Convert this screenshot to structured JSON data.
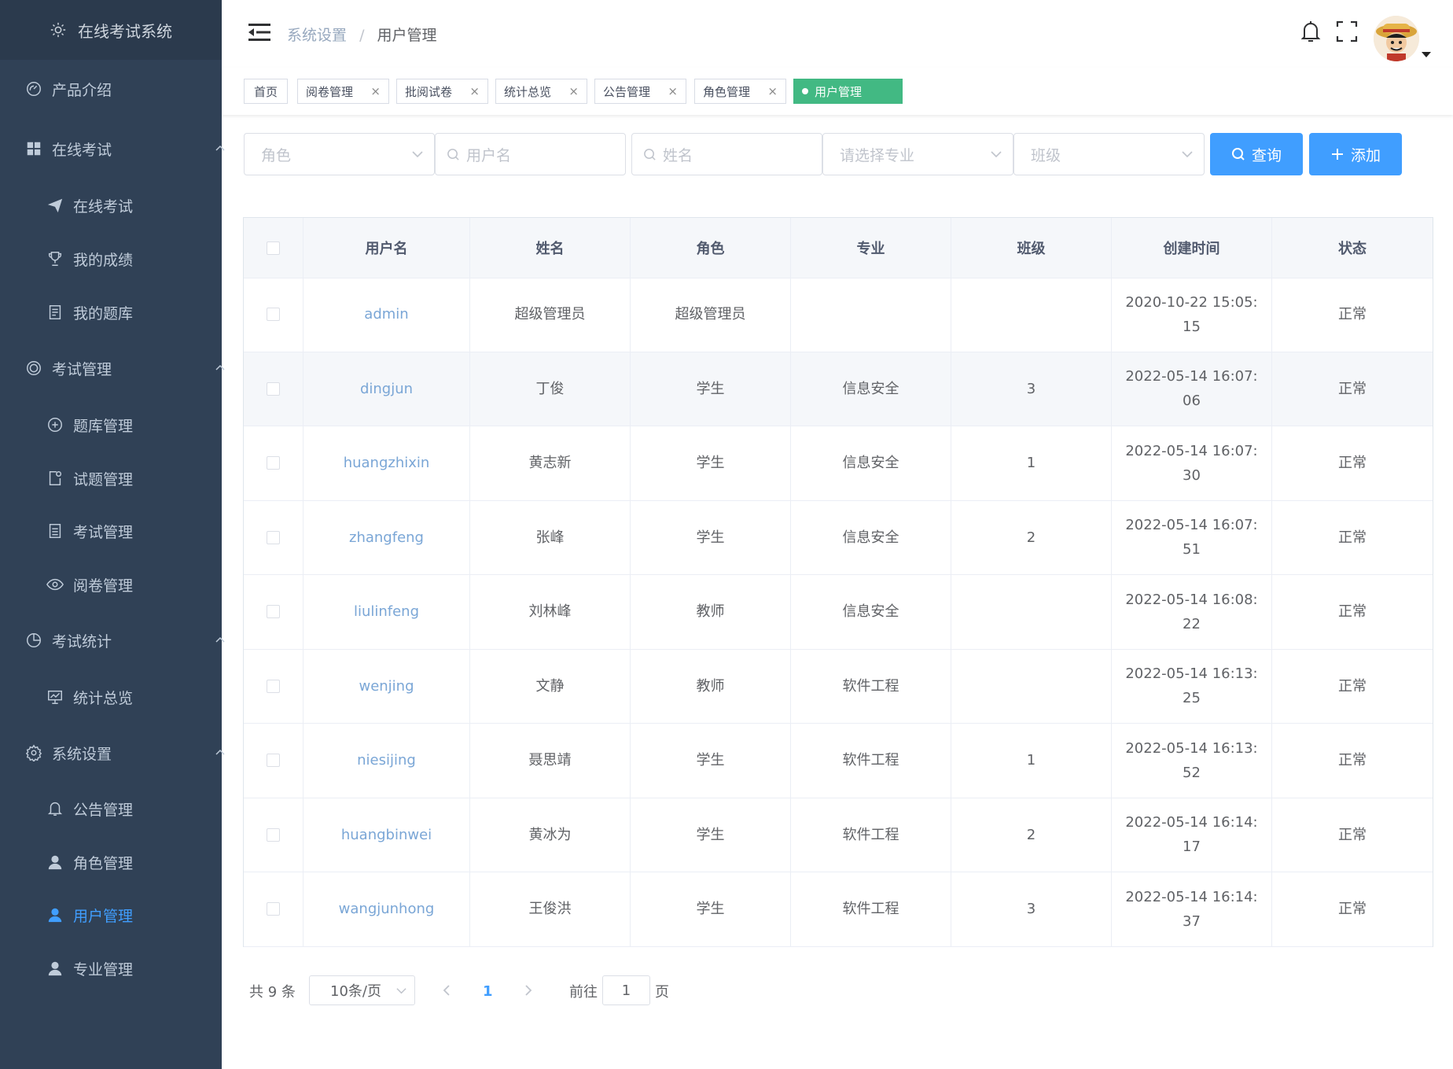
{
  "app": {
    "title": "在线考试系统"
  },
  "sidebar": {
    "items": [
      {
        "label": "产品介绍"
      },
      {
        "label": "在线考试"
      },
      {
        "label": "在线考试"
      },
      {
        "label": "我的成绩"
      },
      {
        "label": "我的题库"
      },
      {
        "label": "考试管理"
      },
      {
        "label": "题库管理"
      },
      {
        "label": "试题管理"
      },
      {
        "label": "考试管理"
      },
      {
        "label": "阅卷管理"
      },
      {
        "label": "考试统计"
      },
      {
        "label": "统计总览"
      },
      {
        "label": "系统设置"
      },
      {
        "label": "公告管理"
      },
      {
        "label": "角色管理"
      },
      {
        "label": "用户管理"
      },
      {
        "label": "专业管理"
      }
    ]
  },
  "breadcrumb": {
    "parent": "系统设置",
    "sep": "/",
    "current": "用户管理"
  },
  "tags": [
    {
      "label": "首页"
    },
    {
      "label": "阅卷管理",
      "close": "×"
    },
    {
      "label": "批阅试卷",
      "close": "×"
    },
    {
      "label": "统计总览",
      "close": "×"
    },
    {
      "label": "公告管理",
      "close": "×"
    },
    {
      "label": "角色管理",
      "close": "×"
    },
    {
      "label": "用户管理"
    }
  ],
  "filters": {
    "role_placeholder": "角色",
    "username_placeholder": "用户名",
    "name_placeholder": "姓名",
    "major_placeholder": "请选择专业",
    "class_placeholder": "班级",
    "query_label": "查询",
    "add_label": "添加"
  },
  "table": {
    "headers": [
      "用户名",
      "姓名",
      "角色",
      "专业",
      "班级",
      "创建时间",
      "状态"
    ],
    "rows": [
      {
        "username": "admin",
        "name": "超级管理员",
        "role": "超级管理员",
        "major": "",
        "class": "",
        "created": "2020-10-22 15:05:15",
        "status": "正常"
      },
      {
        "username": "dingjun",
        "name": "丁俊",
        "role": "学生",
        "major": "信息安全",
        "class": "3",
        "created": "2022-05-14 16:07:06",
        "status": "正常"
      },
      {
        "username": "huangzhixin",
        "name": "黄志新",
        "role": "学生",
        "major": "信息安全",
        "class": "1",
        "created": "2022-05-14 16:07:30",
        "status": "正常"
      },
      {
        "username": "zhangfeng",
        "name": "张峰",
        "role": "学生",
        "major": "信息安全",
        "class": "2",
        "created": "2022-05-14 16:07:51",
        "status": "正常"
      },
      {
        "username": "liulinfeng",
        "name": "刘林峰",
        "role": "教师",
        "major": "信息安全",
        "class": "",
        "created": "2022-05-14 16:08:22",
        "status": "正常"
      },
      {
        "username": "wenjing",
        "name": "文静",
        "role": "教师",
        "major": "软件工程",
        "class": "",
        "created": "2022-05-14 16:13:25",
        "status": "正常"
      },
      {
        "username": "niesijing",
        "name": "聂思靖",
        "role": "学生",
        "major": "软件工程",
        "class": "1",
        "created": "2022-05-14 16:13:52",
        "status": "正常"
      },
      {
        "username": "huangbinwei",
        "name": "黄冰为",
        "role": "学生",
        "major": "软件工程",
        "class": "2",
        "created": "2022-05-14 16:14:17",
        "status": "正常"
      },
      {
        "username": "wangjunhong",
        "name": "王俊洪",
        "role": "学生",
        "major": "软件工程",
        "class": "3",
        "created": "2022-05-14 16:14:37",
        "status": "正常"
      }
    ]
  },
  "pagination": {
    "total_text": "共 9 条",
    "page_size": "10条/页",
    "current_page": "1",
    "goto_label": "前往",
    "goto_value": "1",
    "page_suffix": "页"
  },
  "colors": {
    "sidebar_bg": "#304156",
    "accent": "#409eff",
    "active_tag": "#42b983"
  }
}
